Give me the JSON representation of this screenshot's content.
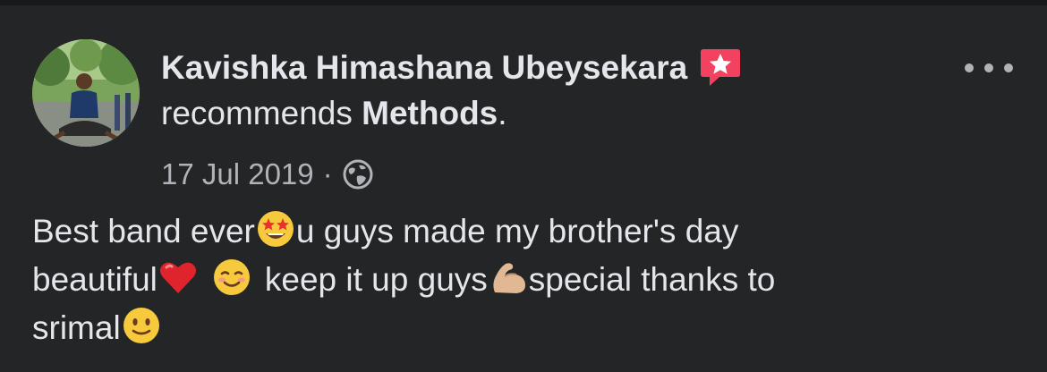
{
  "post": {
    "author": "Kavishka Himashana Ubeysekara",
    "action_text": "recommends ",
    "page_name": "Methods",
    "action_suffix": ".",
    "date": "17 Jul 2019",
    "separator": "·",
    "privacy_icon": "globe-icon",
    "badge_icon": "recommendation-star-icon",
    "more_icon": "more-options-icon",
    "body": {
      "part1": "Best band ever",
      "emoji1": "star-struck-emoji",
      "part2": "u guys made my brother's day",
      "part3": "beautiful",
      "emoji2": "red-heart-emoji",
      "emoji3": "smiling-face-emoji",
      "part4": "keep it up guys",
      "emoji4": "flexed-biceps-emoji",
      "part5": "special thanks to",
      "part6": "srimal",
      "emoji5": "slightly-smiling-face-emoji"
    }
  },
  "colors": {
    "background": "#242526",
    "text_primary": "#e4e6eb",
    "text_secondary": "#b0b3b8",
    "badge": "#f3425f"
  }
}
